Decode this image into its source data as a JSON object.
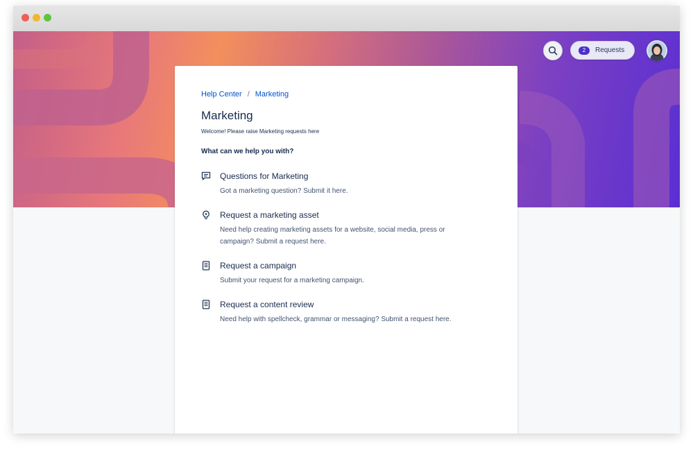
{
  "window": {
    "controls": [
      "close",
      "minimize",
      "zoom"
    ]
  },
  "topnav": {
    "search_icon": "search-icon",
    "requests": {
      "count": "2",
      "label": "Requests"
    },
    "avatar_icon": "user-avatar"
  },
  "breadcrumb": {
    "items": [
      {
        "label": "Help Center"
      },
      {
        "label": "Marketing"
      }
    ],
    "separator": "/"
  },
  "portal": {
    "title": "Marketing",
    "welcome": "Welcome! Please raise Marketing requests here",
    "prompt": "What can we help you with?"
  },
  "request_types": [
    {
      "icon": "chat-bubble-icon",
      "name": "Questions for Marketing",
      "description": "Got a marketing question? Submit it here."
    },
    {
      "icon": "lightbulb-icon",
      "name": "Request a marketing asset",
      "description": "Need help creating marketing assets for a website, social media, press or campaign?  Submit a request here."
    },
    {
      "icon": "document-icon",
      "name": "Request a campaign",
      "description": "Submit your request for a marketing campaign."
    },
    {
      "icon": "document-icon",
      "name": "Request a content review",
      "description": "Need help with spellcheck, grammar or messaging? Submit a request here."
    }
  ],
  "colors": {
    "link": "#0052cc",
    "text_primary": "#172b4d",
    "text_secondary": "#42526e",
    "badge": "#4b2fc9"
  }
}
